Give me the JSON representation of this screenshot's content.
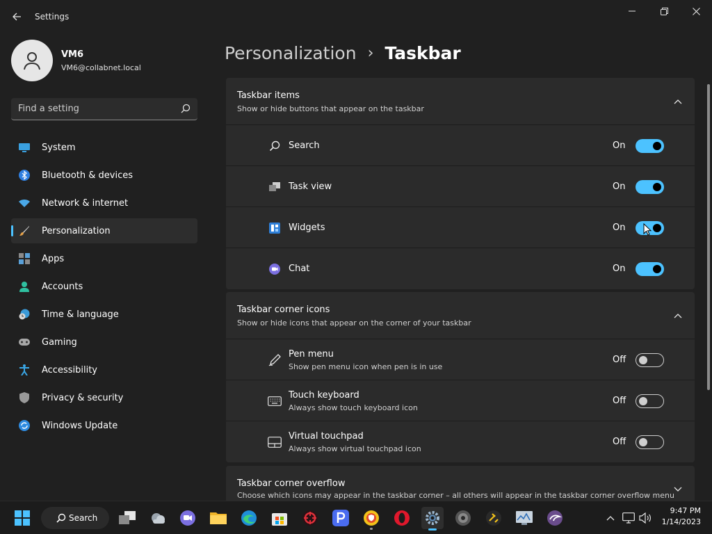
{
  "window": {
    "title": "Settings"
  },
  "profile": {
    "name": "VM6",
    "email": "VM6@collabnet.local"
  },
  "search": {
    "placeholder": "Find a setting"
  },
  "nav": [
    {
      "label": "System",
      "icon": "monitor-icon"
    },
    {
      "label": "Bluetooth & devices",
      "icon": "bluetooth-icon"
    },
    {
      "label": "Network & internet",
      "icon": "wifi-icon"
    },
    {
      "label": "Personalization",
      "icon": "brush-icon",
      "active": true
    },
    {
      "label": "Apps",
      "icon": "apps-icon"
    },
    {
      "label": "Accounts",
      "icon": "person-icon"
    },
    {
      "label": "Time & language",
      "icon": "globe-clock-icon"
    },
    {
      "label": "Gaming",
      "icon": "gamepad-icon"
    },
    {
      "label": "Accessibility",
      "icon": "accessibility-icon"
    },
    {
      "label": "Privacy & security",
      "icon": "shield-icon"
    },
    {
      "label": "Windows Update",
      "icon": "update-icon"
    }
  ],
  "breadcrumb": {
    "parent": "Personalization",
    "separator": "›",
    "current": "Taskbar"
  },
  "sections": [
    {
      "title": "Taskbar items",
      "subtitle": "Show or hide buttons that appear on the taskbar",
      "rows": [
        {
          "title": "Search",
          "state": "On",
          "on": true,
          "icon": "search-icon"
        },
        {
          "title": "Task view",
          "state": "On",
          "on": true,
          "icon": "task-view-icon"
        },
        {
          "title": "Widgets",
          "state": "On",
          "on": true,
          "icon": "widgets-icon"
        },
        {
          "title": "Chat",
          "state": "On",
          "on": true,
          "icon": "chat-icon"
        }
      ]
    },
    {
      "title": "Taskbar corner icons",
      "subtitle": "Show or hide icons that appear on the corner of your taskbar",
      "rows": [
        {
          "title": "Pen menu",
          "desc": "Show pen menu icon when pen is in use",
          "state": "Off",
          "on": false,
          "icon": "pen-icon"
        },
        {
          "title": "Touch keyboard",
          "desc": "Always show touch keyboard icon",
          "state": "Off",
          "on": false,
          "icon": "keyboard-icon"
        },
        {
          "title": "Virtual touchpad",
          "desc": "Always show virtual touchpad icon",
          "state": "Off",
          "on": false,
          "icon": "touchpad-icon"
        }
      ]
    },
    {
      "title": "Taskbar corner overflow",
      "subtitle": "Choose which icons may appear in the taskbar corner – all others will appear in the taskbar corner overflow menu"
    }
  ],
  "taskbar": {
    "search_label": "Search",
    "time": "9:47 PM",
    "date": "1/14/2023"
  },
  "colors": {
    "accent": "#4cc2ff",
    "background": "#202020",
    "card": "#2b2b2b"
  }
}
